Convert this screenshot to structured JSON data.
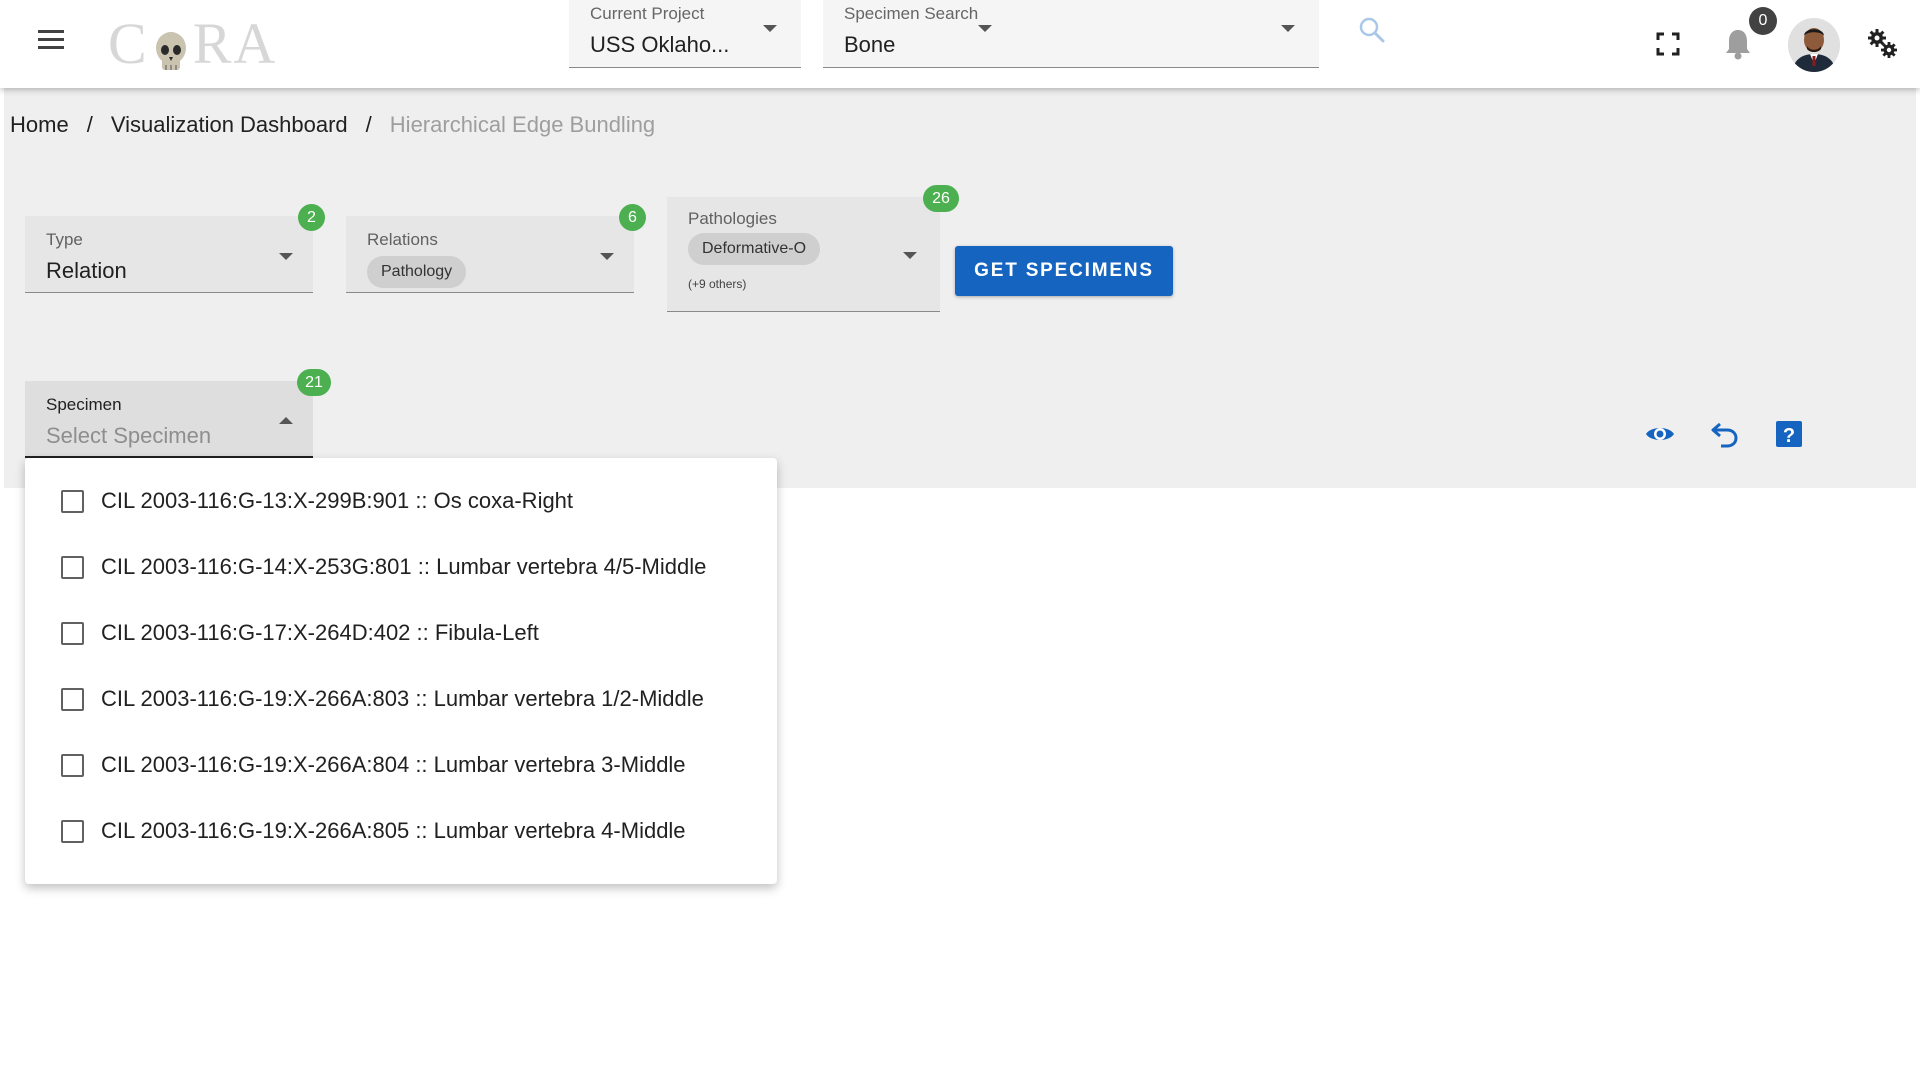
{
  "header": {
    "logo_text": "CORA",
    "current_project": {
      "label": "Current Project",
      "value": "USS Oklaho..."
    },
    "specimen_search": {
      "label": "Specimen Search",
      "value": "Bone"
    },
    "notification_count": "0"
  },
  "breadcrumb": {
    "home": "Home",
    "dashboard": "Visualization Dashboard",
    "current": "Hierarchical Edge Bundling",
    "separator": "/"
  },
  "filters": {
    "type": {
      "label": "Type",
      "value": "Relation",
      "count": "2"
    },
    "relations": {
      "label": "Relations",
      "chip": "Pathology",
      "count": "6"
    },
    "pathologies": {
      "label": "Pathologies",
      "chip": "Deformative-O",
      "more": "(+9 others)",
      "count": "26"
    },
    "get_button": "GET SPECIMENS"
  },
  "specimen": {
    "label": "Specimen",
    "placeholder": "Select Specimen",
    "count": "21",
    "options": [
      "CIL 2003-116:G-13:X-299B:901 :: Os coxa-Right",
      "CIL 2003-116:G-14:X-253G:801 :: Lumbar vertebra 4/5-Middle",
      "CIL 2003-116:G-17:X-264D:402 :: Fibula-Left",
      "CIL 2003-116:G-19:X-266A:803 :: Lumbar vertebra 1/2-Middle",
      "CIL 2003-116:G-19:X-266A:804 :: Lumbar vertebra 3-Middle",
      "CIL 2003-116:G-19:X-266A:805 :: Lumbar vertebra 4-Middle"
    ]
  },
  "colors": {
    "primary": "#1565c0",
    "badge_green": "#4caf50",
    "panel_bg": "#efefef"
  }
}
